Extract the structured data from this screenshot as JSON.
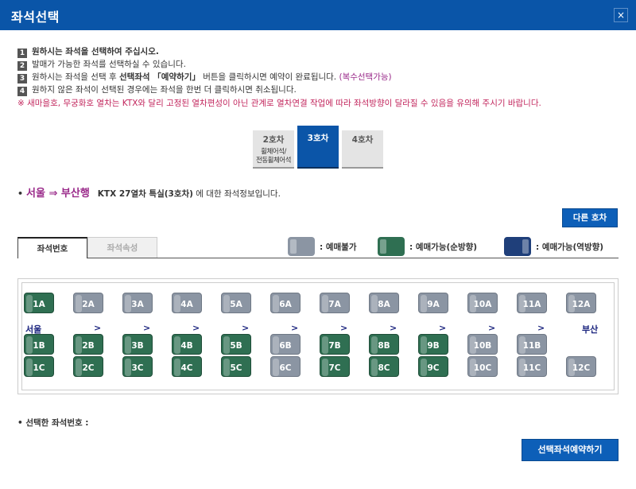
{
  "window": {
    "title": "좌석선택",
    "close_label": "×"
  },
  "instructions": {
    "line1": {
      "num": "1",
      "text": "원하시는 좌석을 선택하여 주십시오."
    },
    "line2": {
      "num": "2",
      "text": "발매가 가능한 좌석를 선택하실 수 있습니다."
    },
    "line3": {
      "num": "3",
      "pre": "원하시는 좌석을 선택 후 ",
      "bold": "선택좌석 「예약하기」",
      "post": " 버튼을 클릭하시면 예약이 완료됩니다.",
      "purple": " (복수선택가능)"
    },
    "line4": {
      "num": "4",
      "text": "원하지 않은 좌석이 선택된 경우에는 좌석을 한번 더 클릭하시면 취소됩니다."
    },
    "warning": "※ 새마을호, 무궁화호 열차는 KTX와 달리 고정된 열차편성이 아닌 관계로 열차연결 작업에 따라 좌석방향이 달라질 수 있음을 유의해 주시기 바랍니다."
  },
  "car_tabs": [
    {
      "label": "2호차",
      "sub1": "휠체어석/",
      "sub2": "전동휠체어석",
      "active": false
    },
    {
      "label": "3호차",
      "active": true
    },
    {
      "label": "4호차",
      "active": false
    }
  ],
  "route": {
    "bullet": "•",
    "destination": "서울 ⇒ 부산행",
    "info": "KTX 27열차   특실(3호차)",
    "tail": " 에 대한 좌석정보입니다."
  },
  "other_car_button": "다른 호차",
  "seat_tabs": {
    "number": "좌석번호",
    "attribute": "좌석속성"
  },
  "legend": {
    "unavailable": ": 예매불가",
    "forward": ": 예매가능(순방향)",
    "reverse": ": 예매가능(역방향)"
  },
  "colors": {
    "available": "#2f6f52",
    "sold": "#8b95a3",
    "reverse": "#1f3f7a",
    "accent": "#0b55a8"
  },
  "stations": {
    "origin": "서울",
    "destination": "부산",
    "arrow": ">"
  },
  "seats": {
    "rowA": [
      {
        "label": "1A",
        "status": "available"
      },
      {
        "label": "2A",
        "status": "sold"
      },
      {
        "label": "3A",
        "status": "sold"
      },
      {
        "label": "4A",
        "status": "sold"
      },
      {
        "label": "5A",
        "status": "sold"
      },
      {
        "label": "6A",
        "status": "sold"
      },
      {
        "label": "7A",
        "status": "sold"
      },
      {
        "label": "8A",
        "status": "sold"
      },
      {
        "label": "9A",
        "status": "sold"
      },
      {
        "label": "10A",
        "status": "sold"
      },
      {
        "label": "11A",
        "status": "sold"
      },
      {
        "label": "12A",
        "status": "sold"
      }
    ],
    "rowB": [
      {
        "label": "1B",
        "status": "available"
      },
      {
        "label": "2B",
        "status": "available"
      },
      {
        "label": "3B",
        "status": "available"
      },
      {
        "label": "4B",
        "status": "available"
      },
      {
        "label": "5B",
        "status": "available"
      },
      {
        "label": "6B",
        "status": "sold"
      },
      {
        "label": "7B",
        "status": "available"
      },
      {
        "label": "8B",
        "status": "available"
      },
      {
        "label": "9B",
        "status": "available"
      },
      {
        "label": "10B",
        "status": "sold"
      },
      {
        "label": "11B",
        "status": "sold"
      }
    ],
    "rowC": [
      {
        "label": "1C",
        "status": "available"
      },
      {
        "label": "2C",
        "status": "available"
      },
      {
        "label": "3C",
        "status": "available"
      },
      {
        "label": "4C",
        "status": "available"
      },
      {
        "label": "5C",
        "status": "available"
      },
      {
        "label": "6C",
        "status": "sold"
      },
      {
        "label": "7C",
        "status": "available"
      },
      {
        "label": "8C",
        "status": "available"
      },
      {
        "label": "9C",
        "status": "available"
      },
      {
        "label": "10C",
        "status": "sold"
      },
      {
        "label": "11C",
        "status": "sold"
      },
      {
        "label": "12C",
        "status": "sold"
      }
    ]
  },
  "selected_seat_label": "• 선택한 좌석번호 :",
  "reserve_button": "선택좌석예약하기"
}
